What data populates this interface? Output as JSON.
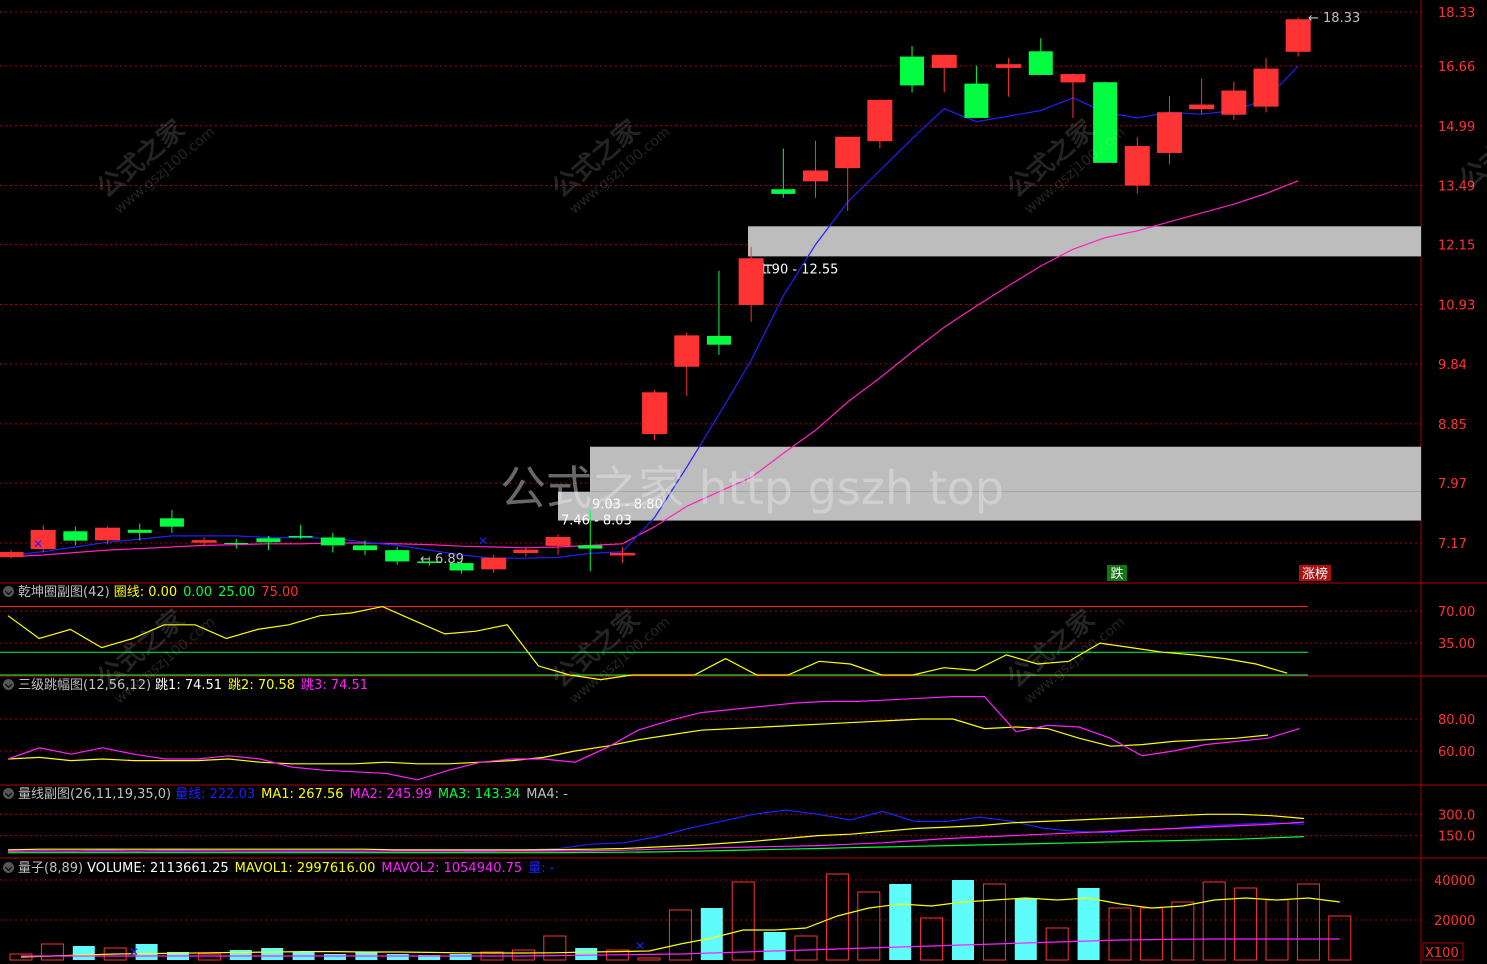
{
  "colors": {
    "up": "#ff3333",
    "down": "#00ff40",
    "grid": "#b00000",
    "axis_text": "#ff3232",
    "ma_short": "#2020ff",
    "ma_long": "#ff20c0",
    "zone": "#bdbdbd",
    "volume_up": "#5ffcfc"
  },
  "watermark": {
    "cn": "公式之家",
    "url": "www.gszj100.com",
    "center": "公式之家 http gszh top"
  },
  "chart_data": [
    {
      "type": "candlestick",
      "panel": "main",
      "y_ticks": [
        "18.33",
        "16.66",
        "14.99",
        "13.49",
        "12.15",
        "10.93",
        "9.84",
        "8.85",
        "7.97",
        "7.17"
      ],
      "ohlc": [
        [
          7.0,
          7.08,
          6.98,
          7.05
        ],
        [
          7.1,
          7.4,
          7.05,
          7.33
        ],
        [
          7.32,
          7.38,
          7.14,
          7.2
        ],
        [
          7.21,
          7.38,
          7.15,
          7.36
        ],
        [
          7.34,
          7.42,
          7.2,
          7.3
        ],
        [
          7.49,
          7.6,
          7.3,
          7.38
        ],
        [
          7.18,
          7.24,
          7.13,
          7.2
        ],
        [
          7.17,
          7.22,
          7.1,
          7.16
        ],
        [
          7.23,
          7.26,
          7.08,
          7.18
        ],
        [
          7.26,
          7.4,
          7.22,
          7.24
        ],
        [
          7.24,
          7.3,
          7.05,
          7.14
        ],
        [
          7.14,
          7.2,
          7.02,
          7.08
        ],
        [
          7.08,
          7.12,
          6.9,
          6.94
        ],
        [
          6.94,
          7.0,
          6.89,
          6.92
        ],
        [
          6.92,
          6.96,
          6.79,
          6.83
        ],
        [
          6.85,
          7.02,
          6.8,
          6.98
        ],
        [
          7.05,
          7.12,
          7.0,
          7.08
        ],
        [
          7.14,
          7.28,
          7.02,
          7.24
        ],
        [
          7.14,
          7.6,
          6.82,
          7.1
        ],
        [
          7.02,
          7.12,
          6.92,
          7.04
        ],
        [
          8.7,
          9.4,
          8.6,
          9.35
        ],
        [
          9.8,
          10.4,
          9.3,
          10.34
        ],
        [
          10.34,
          11.6,
          10.0,
          10.18
        ],
        [
          10.93,
          12.1,
          10.6,
          11.85
        ],
        [
          13.4,
          14.4,
          13.2,
          13.29
        ],
        [
          13.6,
          14.6,
          13.2,
          13.84
        ],
        [
          13.92,
          14.4,
          12.9,
          14.69
        ],
        [
          14.6,
          15.6,
          14.4,
          15.68
        ],
        [
          16.94,
          17.26,
          15.9,
          16.1
        ],
        [
          16.62,
          16.95,
          15.9,
          16.98
        ],
        [
          16.15,
          16.67,
          15.25,
          15.2
        ],
        [
          16.62,
          16.9,
          15.78,
          16.7
        ],
        [
          17.1,
          17.5,
          16.4,
          16.4
        ],
        [
          16.2,
          16.44,
          15.2,
          16.41
        ],
        [
          16.19,
          16.2,
          14.2,
          14.04
        ],
        [
          13.5,
          14.7,
          13.3,
          14.45
        ],
        [
          14.3,
          15.8,
          14.0,
          15.34
        ],
        [
          15.45,
          16.3,
          15.3,
          15.55
        ],
        [
          15.3,
          16.2,
          15.15,
          15.94
        ],
        [
          15.52,
          16.9,
          15.35,
          16.57
        ],
        [
          17.1,
          18.15,
          16.94,
          18.08
        ]
      ],
      "ma_short": [
        7.02,
        7.06,
        7.12,
        7.18,
        7.22,
        7.26,
        7.26,
        7.26,
        7.24,
        7.24,
        7.23,
        7.18,
        7.14,
        7.08,
        7.02,
        6.98,
        6.98,
        6.99,
        7.04,
        7.06,
        7.5,
        8.2,
        9.0,
        9.9,
        11.1,
        12.15,
        13.1,
        13.85,
        14.65,
        15.45,
        15.1,
        15.25,
        15.4,
        15.75,
        15.35,
        15.2,
        15.35,
        15.3,
        15.4,
        15.7,
        16.66
      ],
      "ma_long": [
        7.0,
        7.02,
        7.05,
        7.08,
        7.1,
        7.12,
        7.14,
        7.15,
        7.16,
        7.16,
        7.17,
        7.17,
        7.16,
        7.15,
        7.13,
        7.12,
        7.11,
        7.12,
        7.14,
        7.16,
        7.38,
        7.65,
        7.85,
        8.05,
        8.4,
        8.75,
        9.2,
        9.6,
        10.05,
        10.5,
        10.9,
        11.3,
        11.7,
        12.05,
        12.3,
        12.45,
        12.65,
        12.85,
        13.05,
        13.3,
        13.6
      ],
      "zones": [
        {
          "label": "11.90 - 12.55",
          "from": 11.9,
          "to": 12.55
        },
        {
          "label": "9.03 - 8.80",
          "from": 7.85,
          "to": 8.5
        },
        {
          "label": "7.46 - 8.03",
          "from": 7.46,
          "to": 7.85
        }
      ],
      "annotations": [
        "6.89",
        "18.33"
      ],
      "bottom_labels": {
        "fall": "跌",
        "limit_up": "涨榜"
      }
    },
    {
      "type": "line",
      "panel": "indicator1",
      "title": "乾坤圈副图(42)",
      "legend": [
        {
          "text": "圈线: 0.00",
          "color": "#ffff00"
        },
        {
          "text": "0.00",
          "color": "#00ff40"
        },
        {
          "text": "25.00",
          "color": "#00ff40"
        },
        {
          "text": "75.00",
          "color": "#ff3232"
        }
      ],
      "y_ticks": [
        "70.00",
        "35.00"
      ],
      "levels": [
        {
          "value": 75,
          "color": "#ff3232"
        },
        {
          "value": 25,
          "color": "#00ff40"
        },
        {
          "value": 0,
          "color": "#00ff40"
        }
      ],
      "series": [
        {
          "color": "#ffff00",
          "values": [
            65,
            40,
            50,
            30,
            40,
            55,
            55,
            40,
            50,
            55,
            65,
            68,
            75,
            60,
            45,
            48,
            55,
            10,
            0,
            -5,
            0,
            0,
            0,
            18,
            0,
            0,
            15,
            12,
            0,
            0,
            8,
            5,
            22,
            12,
            15,
            35,
            30,
            25,
            22,
            18,
            12,
            2
          ]
        }
      ]
    },
    {
      "type": "line",
      "panel": "indicator2",
      "title": "三级跳幅图(12,56,12)",
      "legend": [
        {
          "text": "跳1: 74.51",
          "color": "#ffffff"
        },
        {
          "text": "跳2: 70.58",
          "color": "#ffff00"
        },
        {
          "text": "跳3: 74.51",
          "color": "#ff20ff"
        }
      ],
      "y_ticks": [
        "80.00",
        "60.00"
      ],
      "series": [
        {
          "color": "#ffff00",
          "values": [
            55,
            56,
            54,
            55,
            54,
            54,
            54,
            55,
            53,
            52,
            52,
            52,
            53,
            52,
            52,
            53,
            54,
            56,
            60,
            63,
            67,
            70,
            73,
            74,
            75,
            76,
            77,
            78,
            79,
            80,
            80,
            74,
            75,
            74,
            68,
            63,
            64,
            66,
            67,
            68,
            70
          ]
        },
        {
          "color": "#ff20ff",
          "values": [
            55,
            62,
            58,
            62,
            58,
            55,
            55,
            57,
            55,
            50,
            48,
            47,
            46,
            42,
            48,
            53,
            55,
            55,
            53,
            62,
            73,
            79,
            84,
            86,
            88,
            90,
            91,
            91,
            92,
            93,
            94,
            94,
            72,
            76,
            75,
            68,
            57,
            60,
            64,
            66,
            68,
            74
          ]
        }
      ]
    },
    {
      "type": "line",
      "panel": "indicator3",
      "title": "量线副图(26,11,19,35,0)",
      "legend": [
        {
          "text": "量线: 222.03",
          "color": "#2020ff"
        },
        {
          "text": "MA1: 267.56",
          "color": "#ffff00"
        },
        {
          "text": "MA2: 245.99",
          "color": "#ff20ff"
        },
        {
          "text": "MA3: 143.34",
          "color": "#00ff40"
        },
        {
          "text": "MA4: -",
          "color": "#c0c0c0"
        }
      ],
      "y_ticks": [
        "300.0",
        "150.0"
      ],
      "series": [
        {
          "color": "#2020ff",
          "values": [
            40,
            45,
            40,
            50,
            40,
            50,
            45,
            42,
            40,
            38,
            35,
            32,
            30,
            30,
            32,
            40,
            50,
            60,
            90,
            100,
            140,
            200,
            250,
            300,
            330,
            300,
            260,
            320,
            250,
            250,
            280,
            250,
            200,
            180,
            170,
            190,
            200,
            220,
            230,
            240,
            230
          ]
        },
        {
          "color": "#ffff00",
          "values": [
            50,
            55,
            55,
            55,
            55,
            55,
            55,
            55,
            55,
            55,
            55,
            55,
            50,
            50,
            50,
            50,
            50,
            52,
            55,
            60,
            70,
            80,
            95,
            110,
            130,
            150,
            160,
            180,
            200,
            210,
            220,
            240,
            250,
            260,
            270,
            280,
            290,
            300,
            300,
            290,
            270
          ]
        },
        {
          "color": "#ff20ff",
          "values": [
            40,
            42,
            42,
            42,
            42,
            42,
            42,
            42,
            42,
            42,
            42,
            42,
            42,
            42,
            42,
            42,
            42,
            42,
            45,
            48,
            55,
            60,
            65,
            70,
            75,
            80,
            90,
            100,
            115,
            130,
            140,
            150,
            160,
            170,
            180,
            190,
            200,
            210,
            220,
            230,
            245
          ]
        },
        {
          "color": "#00ff40",
          "values": [
            30,
            30,
            30,
            30,
            30,
            30,
            30,
            30,
            30,
            30,
            30,
            30,
            30,
            30,
            30,
            30,
            30,
            30,
            32,
            34,
            36,
            40,
            45,
            50,
            55,
            60,
            65,
            70,
            75,
            80,
            85,
            90,
            95,
            100,
            105,
            110,
            115,
            120,
            125,
            135,
            143
          ]
        }
      ]
    },
    {
      "type": "bar",
      "panel": "volume",
      "title": "量子(8,89)",
      "legend": [
        {
          "text": "VOLUME: 2113661.25",
          "color": "#ffffff"
        },
        {
          "text": "MAVOL1: 2997616.00",
          "color": "#ffff00"
        },
        {
          "text": "MAVOL2: 1054940.75",
          "color": "#ff20ff"
        },
        {
          "text": "量: -",
          "color": "#2020ff"
        }
      ],
      "y_ticks": [
        "40000",
        "20000"
      ],
      "unit": "X100",
      "values": [
        3000,
        8000,
        7000,
        6000,
        8000,
        4000,
        3000,
        5000,
        6000,
        4000,
        3000,
        4000,
        3000,
        2500,
        3000,
        4000,
        5000,
        12000,
        6000,
        5000,
        1000,
        25000,
        26000,
        39000,
        14000,
        12000,
        43000,
        34000,
        38000,
        21000,
        40000,
        38000,
        31000,
        16000,
        36000,
        26000,
        26000,
        29000,
        39000,
        36000,
        30000,
        38000,
        22000
      ],
      "mavol1": [
        1500,
        2000,
        2500,
        3000,
        3200,
        3400,
        3600,
        3800,
        4000,
        4200,
        4200,
        4000,
        4000,
        3800,
        3600,
        3500,
        3500,
        3600,
        4000,
        4200,
        4500,
        8000,
        11000,
        15000,
        15000,
        16000,
        22000,
        26000,
        28000,
        27000,
        29000,
        30000,
        31000,
        30000,
        31000,
        28000,
        26000,
        27000,
        30000,
        31000,
        30000,
        31000,
        29000
      ],
      "mavol2": [
        2000,
        2000,
        2000,
        2000,
        2000,
        2000,
        2000,
        2000,
        2000,
        2000,
        2000,
        2000,
        2000,
        2000,
        2000,
        2000,
        2000,
        2200,
        2400,
        2600,
        2800,
        3000,
        3500,
        4000,
        4500,
        5000,
        5500,
        6000,
        6500,
        7000,
        7500,
        8000,
        8500,
        9000,
        9500,
        10000,
        10200,
        10400,
        10500,
        10500,
        10500,
        10500,
        10500
      ]
    }
  ]
}
